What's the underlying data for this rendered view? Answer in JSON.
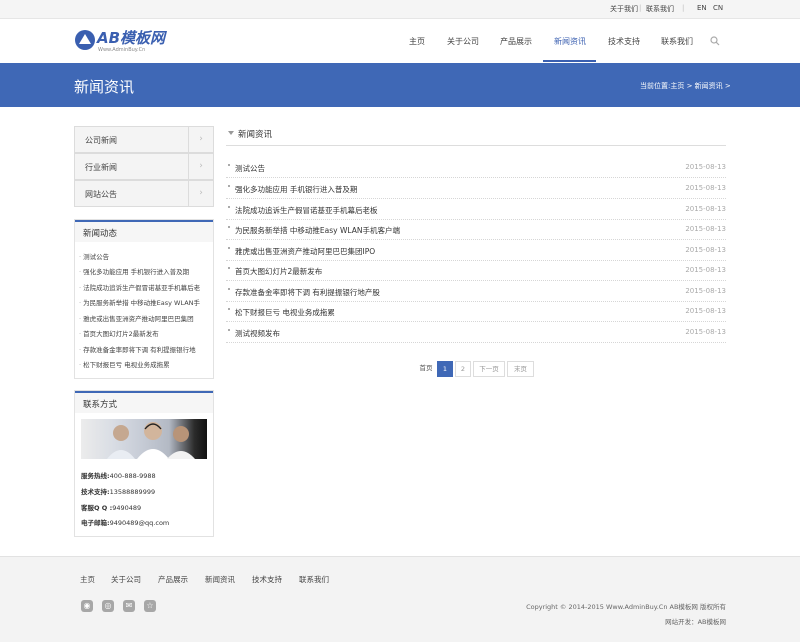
{
  "topbar": {
    "about": "关于我们",
    "contact": "联系我们",
    "en": "EN",
    "cn": "CN"
  },
  "logo": {
    "text": "AB模板网",
    "sub": "Www.AdminBuy.Cn"
  },
  "nav": [
    "主页",
    "关于公司",
    "产品展示",
    "新闻资讯",
    "技术支持",
    "联系我们"
  ],
  "banner": {
    "title": "新闻资讯",
    "crumb": "当前位置:主页 > 新闻资讯 >"
  },
  "sidebar": {
    "menu": [
      "公司新闻",
      "行业新闻",
      "网站公告"
    ],
    "news_title": "新闻动态",
    "news": [
      "测试公告",
      "强化多功能应用 手机银行进入普及期",
      "法院成功追诉生产假冒诺基亚手机幕后老",
      "为民服务新举措 中移动推Easy WLAN手",
      "雅虎或出售亚洲资产推动阿里巴巴集团",
      "首页大图幻灯片2最新发布",
      "存款准备金率即将下调 有利提振银行地",
      "松下财报巨亏 电视业务成拖累"
    ],
    "contact_title": "联系方式",
    "contact": [
      {
        "label": "服务热线:",
        "value": "400-888-9988"
      },
      {
        "label": "技术支持:",
        "value": "13588889999"
      },
      {
        "label": "客服Q Q :",
        "value": "9490489"
      },
      {
        "label": "电子邮箱:",
        "value": "9490489@qq.com"
      }
    ]
  },
  "main": {
    "title": "新闻资讯",
    "items": [
      {
        "title": "测试公告",
        "date": "2015-08-13"
      },
      {
        "title": "强化多功能应用 手机银行进入普及期",
        "date": "2015-08-13"
      },
      {
        "title": "法院成功追诉生产假冒诺基亚手机幕后老板",
        "date": "2015-08-13"
      },
      {
        "title": "为民服务新举措 中移动推Easy WLAN手机客户端",
        "date": "2015-08-13"
      },
      {
        "title": "雅虎或出售亚洲资产推动阿里巴巴集团IPO",
        "date": "2015-08-13"
      },
      {
        "title": "首页大图幻灯片2最新发布",
        "date": "2015-08-13"
      },
      {
        "title": "存款准备金率即将下调 有利提振银行地产股",
        "date": "2015-08-13"
      },
      {
        "title": "松下财报巨亏 电视业务成拖累",
        "date": "2015-08-13"
      },
      {
        "title": "测试视频发布",
        "date": "2015-08-13"
      }
    ],
    "pagination": {
      "first": "首页",
      "p1": "1",
      "p2": "2",
      "next": "下一页",
      "last": "末页"
    }
  },
  "footer": {
    "nav": [
      "主页",
      "关于公司",
      "产品展示",
      "新闻资讯",
      "技术支持",
      "联系我们"
    ],
    "social_icons": [
      "weibo-icon",
      "tencent-icon",
      "chat-icon",
      "star-icon"
    ],
    "copyright": "Copyright © 2014-2015 Www.AdminBuy.Cn AB模板网 版权所有",
    "dev": "网站开发：AB模板网"
  },
  "colors": {
    "accent": "#3f68b6"
  }
}
